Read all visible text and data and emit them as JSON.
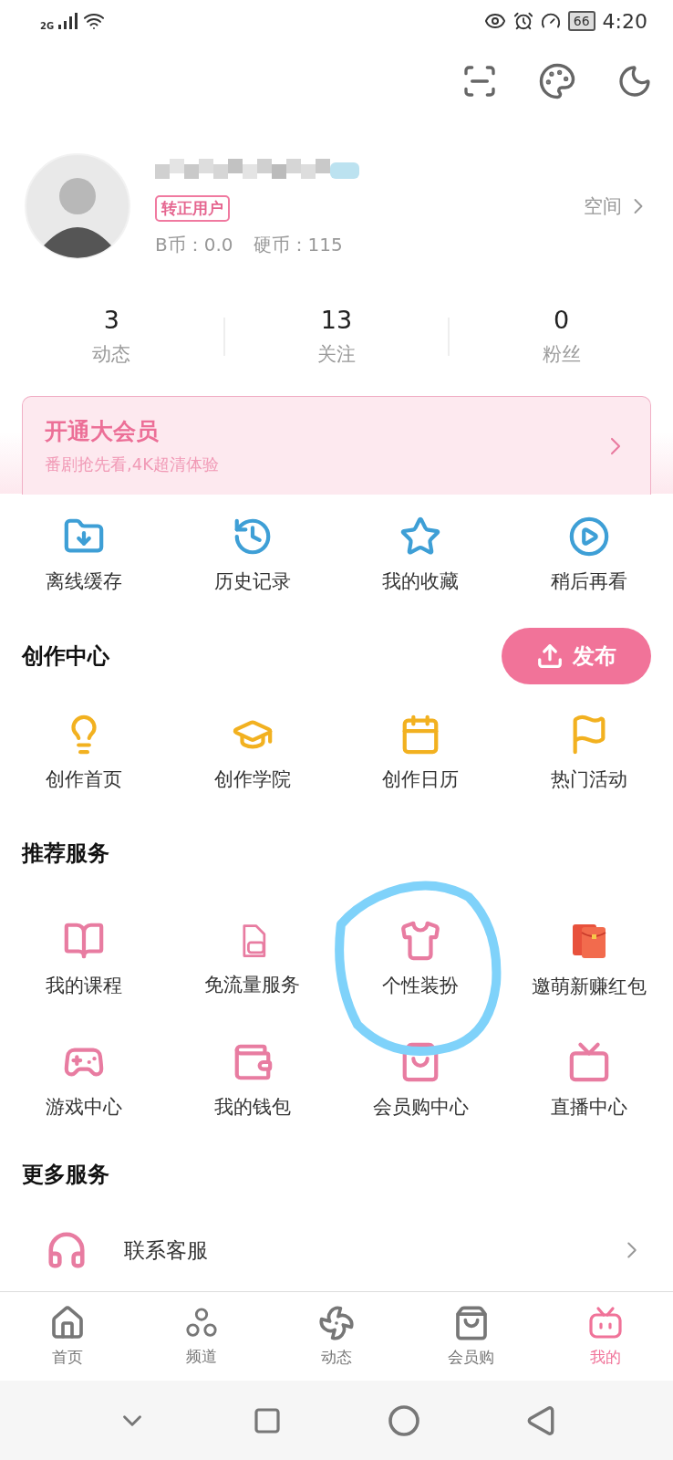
{
  "status_bar": {
    "network": "2G",
    "battery": "66",
    "time": "4:20"
  },
  "profile": {
    "badge": "转正用户",
    "coins": [
      {
        "label": "B币：0.0"
      },
      {
        "label": "硬币：115"
      }
    ],
    "space_link": "空间"
  },
  "stats": [
    {
      "value": "3",
      "label": "动态"
    },
    {
      "value": "13",
      "label": "关注"
    },
    {
      "value": "0",
      "label": "粉丝"
    }
  ],
  "vip_banner": {
    "title": "开通大会员",
    "subtitle": "番剧抢先看,4K超清体验"
  },
  "quick_actions": [
    {
      "kind": "download",
      "label": "离线缓存"
    },
    {
      "kind": "history",
      "label": "历史记录"
    },
    {
      "kind": "star",
      "label": "我的收藏"
    },
    {
      "kind": "later",
      "label": "稍后再看"
    }
  ],
  "creation_center": {
    "title": "创作中心",
    "publish_button": "发布",
    "items": [
      {
        "kind": "bulb",
        "label": "创作首页"
      },
      {
        "kind": "cap",
        "label": "创作学院"
      },
      {
        "kind": "calendar",
        "label": "创作日历"
      },
      {
        "kind": "flag",
        "label": "热门活动"
      }
    ]
  },
  "recommended_services": {
    "title": "推荐服务",
    "items": [
      {
        "kind": "book",
        "label": "我的课程"
      },
      {
        "kind": "sim",
        "label": "免流量服务"
      },
      {
        "kind": "shirt",
        "label": "个性装扮"
      },
      {
        "kind": "envelope",
        "label": "邀萌新赚红包"
      },
      {
        "kind": "gamepad",
        "label": "游戏中心"
      },
      {
        "kind": "wallet",
        "label": "我的钱包"
      },
      {
        "kind": "bag",
        "label": "会员购中心"
      },
      {
        "kind": "tv",
        "label": "直播中心"
      }
    ]
  },
  "more_services": {
    "title": "更多服务",
    "items": [
      {
        "label": "联系客服"
      }
    ]
  },
  "bottom_nav": [
    {
      "kind": "home",
      "label": "首页",
      "selected": false
    },
    {
      "kind": "channels",
      "label": "频道",
      "selected": false
    },
    {
      "kind": "pinwheel",
      "label": "动态",
      "selected": false
    },
    {
      "kind": "bag",
      "label": "会员购",
      "selected": false
    },
    {
      "kind": "tv",
      "label": "我的",
      "selected": true
    }
  ]
}
